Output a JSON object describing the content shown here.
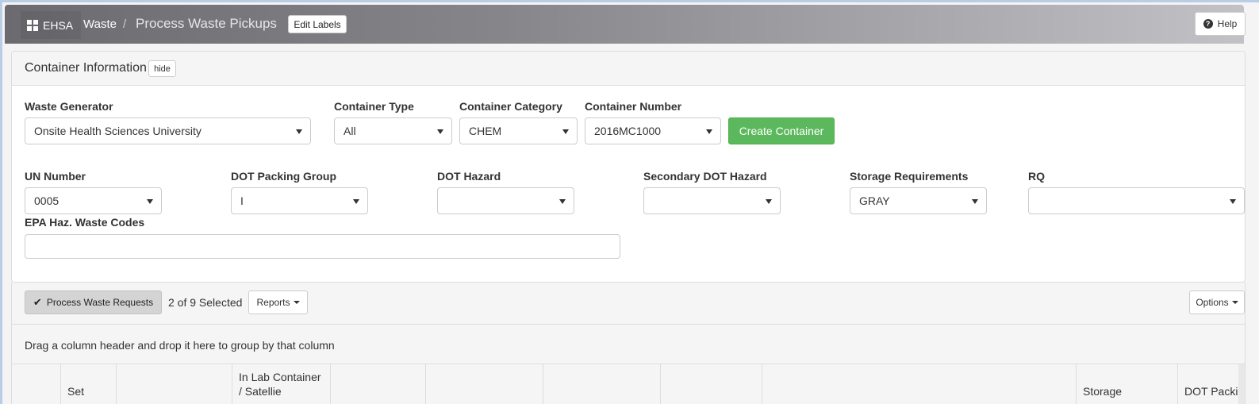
{
  "header": {
    "brand": "EHSA",
    "breadcrumb_parent": "Waste",
    "breadcrumb_sep": "/",
    "page_title": "Process Waste Pickups",
    "edit_labels": "Edit Labels",
    "help": "Help"
  },
  "panel": {
    "title": "Container Information",
    "hide": "hide",
    "waste_generator": {
      "label": "Waste Generator",
      "value": "Onsite Health Sciences University"
    },
    "container_type": {
      "label": "Container Type",
      "value": "All"
    },
    "container_category": {
      "label": "Container Category",
      "value": "CHEM"
    },
    "container_number": {
      "label": "Container Number",
      "value": "2016MC1000"
    },
    "create_container": "Create Container",
    "un_number": {
      "label": "UN Number",
      "value": "0005"
    },
    "dot_packing_group": {
      "label": "DOT Packing Group",
      "value": "I"
    },
    "dot_hazard": {
      "label": "DOT Hazard",
      "value": ""
    },
    "secondary_dot_hazard": {
      "label": "Secondary DOT Hazard",
      "value": ""
    },
    "storage_requirements": {
      "label": "Storage Requirements",
      "value": "GRAY"
    },
    "rq": {
      "label": "RQ",
      "value": ""
    },
    "epa_codes": {
      "label": "EPA Haz. Waste Codes",
      "value": ""
    }
  },
  "toolbar": {
    "process": "Process Waste Requests",
    "selected": "2 of 9 Selected",
    "reports": "Reports",
    "options": "Options"
  },
  "grid": {
    "group_hint": "Drag a column header and drop it here to group by that column",
    "columns": [
      "",
      "Set",
      "",
      "In Lab Container / Satellie",
      "",
      "",
      "",
      "",
      "",
      "Storage",
      "DOT Packi"
    ]
  }
}
